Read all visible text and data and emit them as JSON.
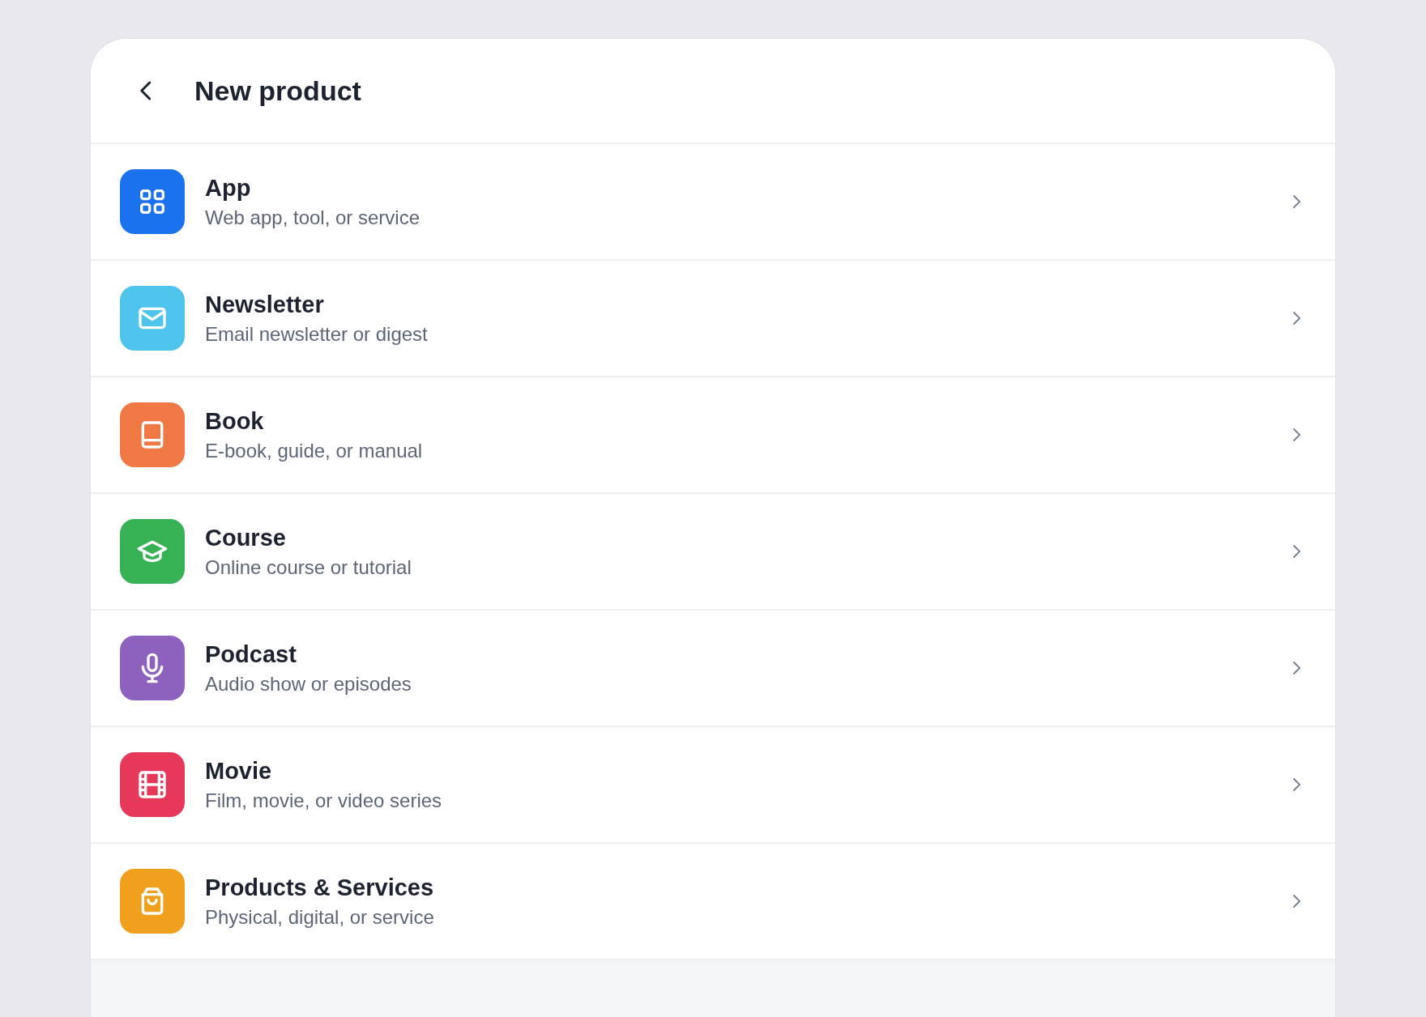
{
  "header": {
    "title": "New product"
  },
  "items": [
    {
      "kind": "grid",
      "color": "#1a72ee",
      "title": "App",
      "subtitle": "Web app, tool, or service"
    },
    {
      "kind": "mail",
      "color": "#4ec3ec",
      "title": "Newsletter",
      "subtitle": "Email newsletter or digest"
    },
    {
      "kind": "book",
      "color": "#f07844",
      "title": "Book",
      "subtitle": "E-book, guide, or manual"
    },
    {
      "kind": "cap",
      "color": "#36b255",
      "title": "Course",
      "subtitle": "Online course or tutorial"
    },
    {
      "kind": "mic",
      "color": "#8d62be",
      "title": "Podcast",
      "subtitle": "Audio show or episodes"
    },
    {
      "kind": "film",
      "color": "#e8385a",
      "title": "Movie",
      "subtitle": "Film, movie, or video series"
    },
    {
      "kind": "bag",
      "color": "#f0a01c",
      "title": "Products & Services",
      "subtitle": "Physical, digital, or service"
    }
  ]
}
